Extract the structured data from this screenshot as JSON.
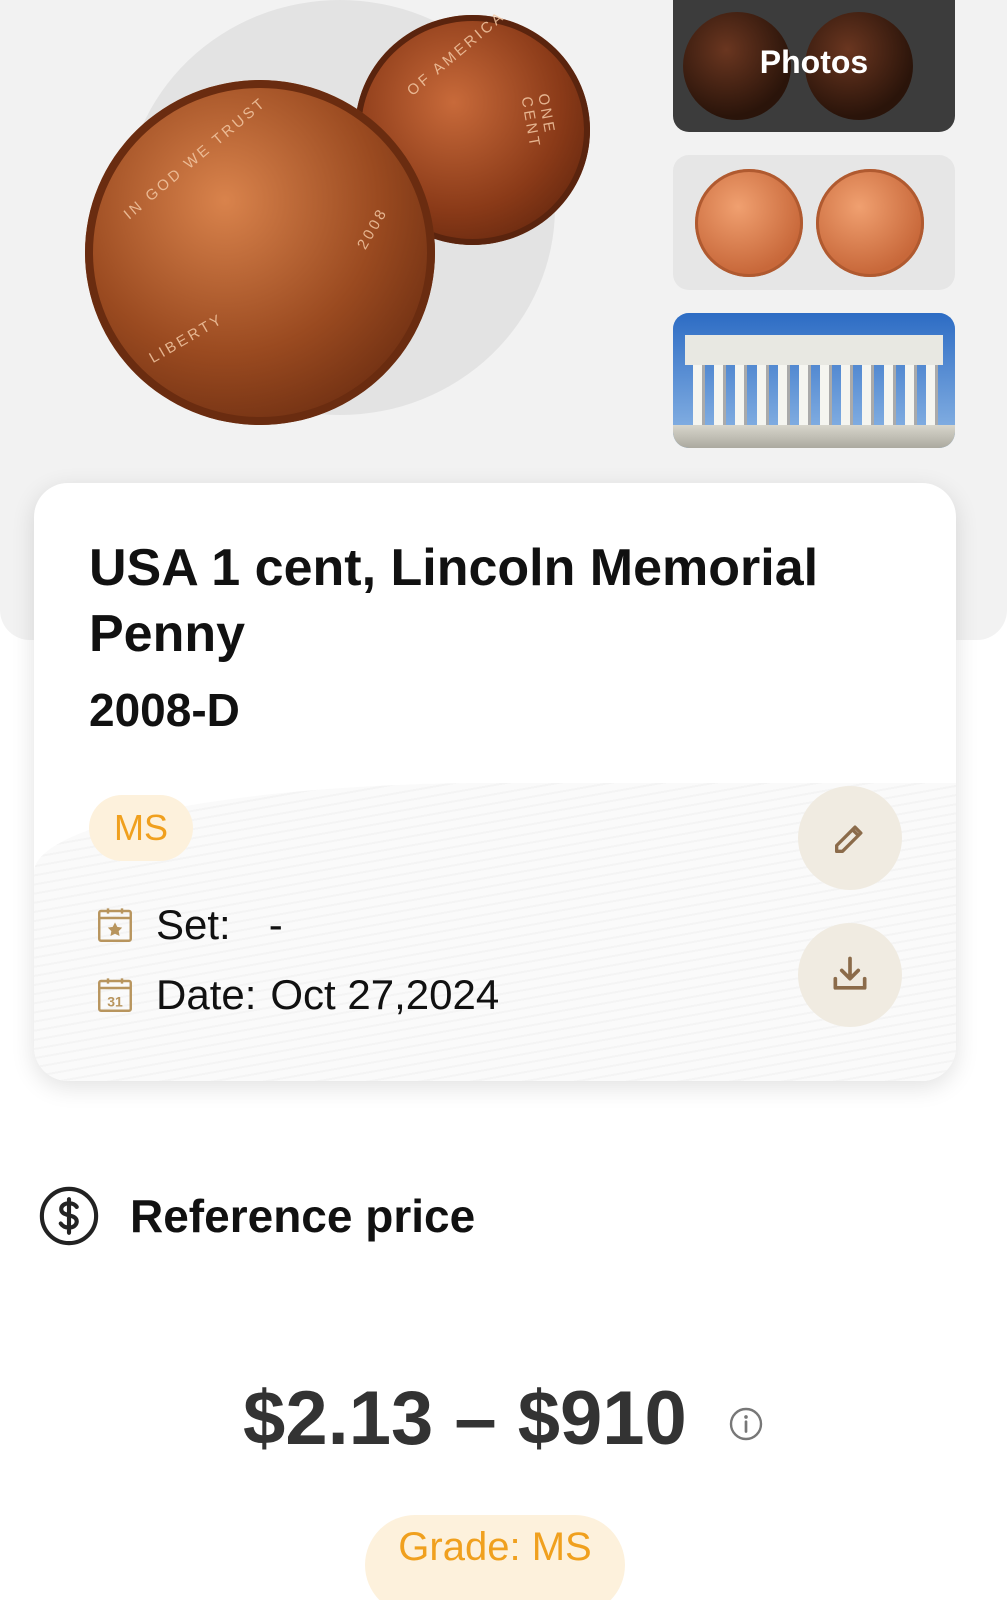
{
  "gallery": {
    "photos_label": "Photos"
  },
  "coin_imprint": {
    "motto": "IN GOD WE TRUST",
    "liberty": "LIBERTY",
    "year": "2008",
    "reverse_top": "OF AMERICA",
    "reverse_bottom": "ONE CENT"
  },
  "card": {
    "title": "USA 1 cent, Lincoln Memorial Penny",
    "year_mint": "2008-D",
    "grade_badge": "MS",
    "set_label": "Set:",
    "set_value": "-",
    "date_label": "Date:",
    "date_value": "Oct 27,2024",
    "calendar_day": "31"
  },
  "reference": {
    "title": "Reference price",
    "price_range": "$2.13 – $910",
    "grade_pill": "Grade: MS"
  },
  "colors": {
    "accent": "#f0a01e",
    "badge_bg": "#fdf1dc",
    "action_bg": "#f0ebe1",
    "icon_brown": "#8b6b4a"
  }
}
